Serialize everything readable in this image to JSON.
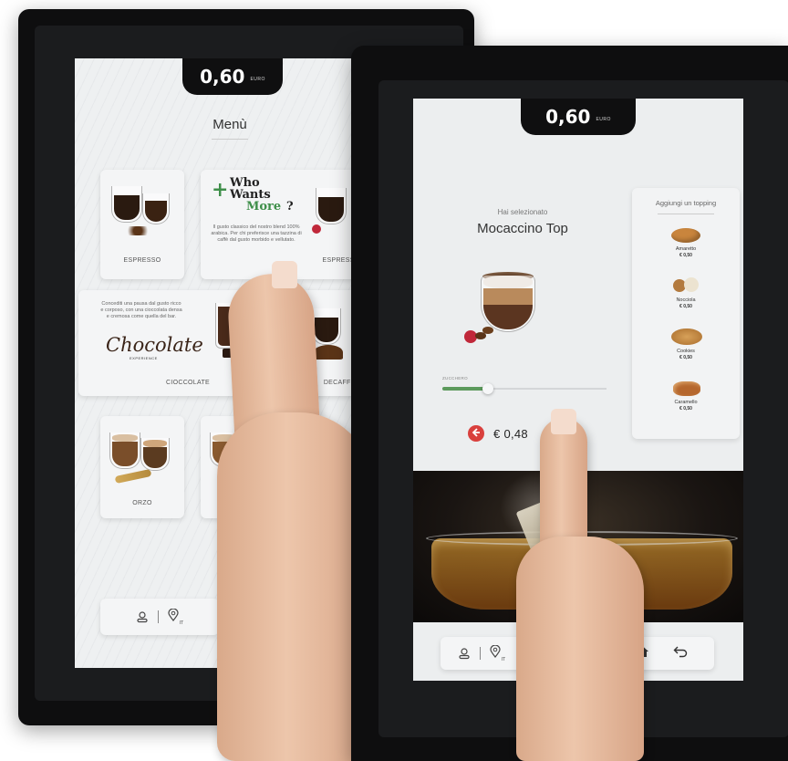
{
  "back_kiosk": {
    "credit": {
      "amount": "0,60",
      "currency": "EURO"
    },
    "menu_title": "Menù",
    "cards": [
      {
        "label": "ESPRESSO"
      },
      {
        "label": "ESPRESSO"
      },
      {
        "label": "CIOCCOLATE"
      },
      {
        "label": "DECAFFEIN"
      },
      {
        "label": "ORZO"
      }
    ],
    "promo": {
      "plus": "+",
      "line1": "Who",
      "line2": "Wants",
      "line3": "More",
      "question": "?",
      "description": "Il gusto classico del nostro blend 100% arabica. Per chi preferisce una tazzina di caffè dal gusto morbido e vellutato."
    },
    "chocolate_promo": {
      "description": "Concediti una pausa dal gusto ricco e corposo, con una cioccolata densa e cremosa come quella del bar.",
      "logo_text": "Chocolate",
      "logo_sub": "EXPERIENCE"
    },
    "bottom_bar": {
      "language": "IT"
    }
  },
  "front_kiosk": {
    "credit": {
      "amount": "0,60",
      "currency": "EURO"
    },
    "selected_label": "Hai selezionato",
    "product_name": "Mocaccino Top",
    "sugar": {
      "label": "ZUCCHERO",
      "level": 0.28
    },
    "price": "€ 0,48",
    "topping_title": "Aggiungi un topping",
    "toppings": [
      {
        "name": "Amaretto",
        "price": "€ 0,50",
        "color": "#c9853d"
      },
      {
        "name": "Nocciola",
        "price": "€ 0,50",
        "color": "#b37a3e"
      },
      {
        "name": "Cookies",
        "price": "€ 0,50",
        "color": "#c98f3e"
      },
      {
        "name": "Caramello",
        "price": "€ 0,50",
        "color": "#b5672e"
      }
    ],
    "bottom_bar": {
      "language": "IT"
    }
  }
}
